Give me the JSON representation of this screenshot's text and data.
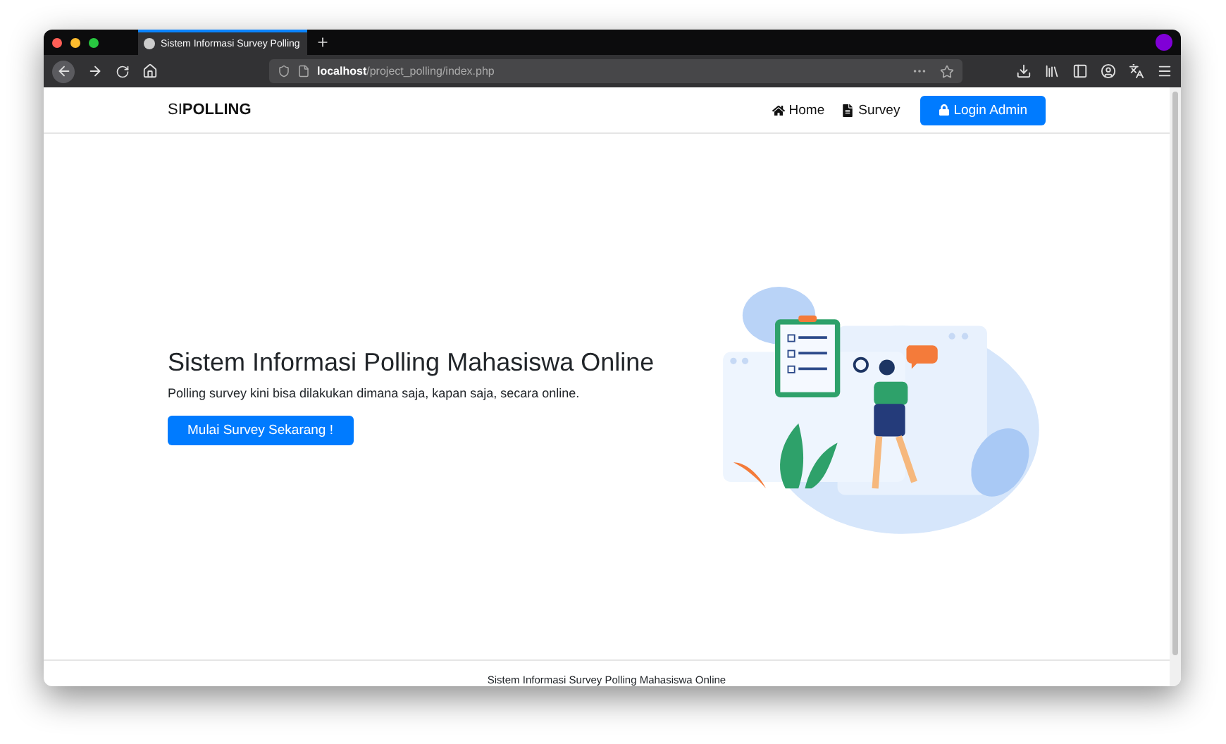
{
  "browser": {
    "tab_title": "Sistem Informasi Survey Polling",
    "url_host": "localhost",
    "url_path": "/project_polling/index.php"
  },
  "navbar": {
    "brand": "SI**POLLING**",
    "links": [
      {
        "label": "Home"
      },
      {
        "label": "Survey"
      }
    ],
    "login_button": "Login Admin"
  },
  "hero": {
    "title": "Sistem Informasi Polling Mahasiswa Online",
    "subtitle": "Polling survey kini bisa dilakukan dimana saja, kapan saja, secara online.",
    "button": "Mulai Survey Sekarang !"
  },
  "footer": {
    "text": "Sistem Informasi Survey Polling Mahasiswa Online"
  }
}
